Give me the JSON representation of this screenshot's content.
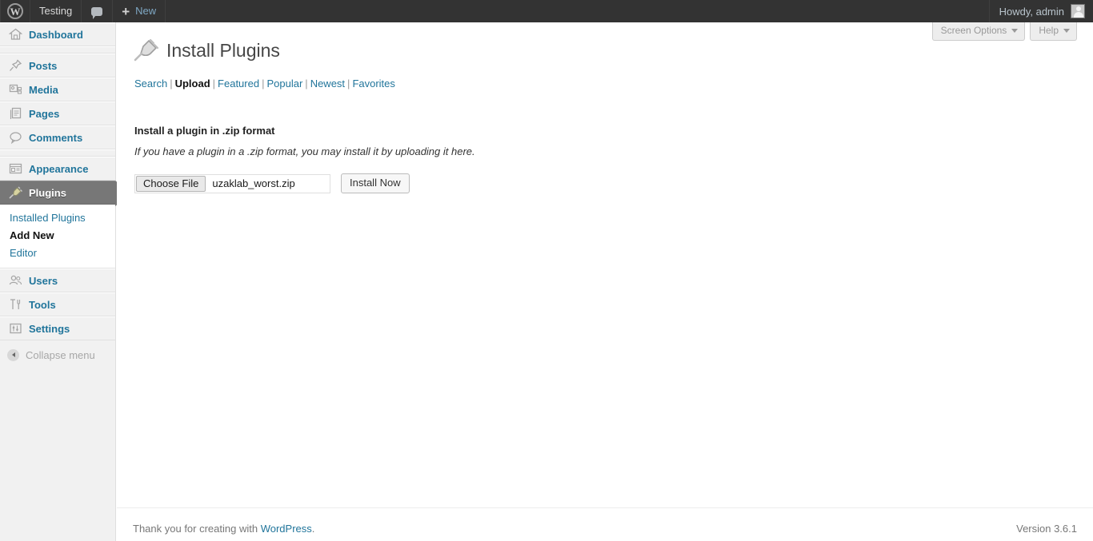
{
  "adminbar": {
    "logo_icon": "wordpress-logo-icon",
    "site_name": "Testing",
    "comments_icon": "comment-bubble-icon",
    "new_plus": "+",
    "new_label": "New",
    "howdy": "Howdy, admin",
    "avatar_icon": "user-avatar-icon"
  },
  "sidebar": {
    "items": [
      {
        "label": "Dashboard",
        "icon": "dashboard-home-icon",
        "current": false
      },
      {
        "label": "Posts",
        "icon": "posts-pin-icon",
        "current": false
      },
      {
        "label": "Media",
        "icon": "media-icon",
        "current": false
      },
      {
        "label": "Pages",
        "icon": "pages-icon",
        "current": false
      },
      {
        "label": "Comments",
        "icon": "comments-icon",
        "current": false
      },
      {
        "label": "Appearance",
        "icon": "appearance-icon",
        "current": false
      },
      {
        "label": "Plugins",
        "icon": "plugins-plug-icon",
        "current": true
      },
      {
        "label": "Users",
        "icon": "users-icon",
        "current": false
      },
      {
        "label": "Tools",
        "icon": "tools-icon",
        "current": false
      },
      {
        "label": "Settings",
        "icon": "settings-icon",
        "current": false
      }
    ],
    "plugins_submenu": [
      {
        "label": "Installed Plugins",
        "current": false
      },
      {
        "label": "Add New",
        "current": true
      },
      {
        "label": "Editor",
        "current": false
      }
    ],
    "collapse": {
      "label": "Collapse menu",
      "icon": "collapse-arrow-icon"
    }
  },
  "screen_meta": {
    "screen_options": "Screen Options",
    "help": "Help"
  },
  "main": {
    "page_icon": "plugin-plug-icon",
    "page_title": "Install Plugins",
    "tabs": [
      {
        "label": "Search",
        "current": false
      },
      {
        "label": "Upload",
        "current": true
      },
      {
        "label": "Featured",
        "current": false
      },
      {
        "label": "Popular",
        "current": false
      },
      {
        "label": "Newest",
        "current": false
      },
      {
        "label": "Favorites",
        "current": false
      }
    ],
    "tab_separator": "|",
    "upload": {
      "heading": "Install a plugin in .zip format",
      "description": "If you have a plugin in a .zip format, you may install it by uploading it here.",
      "choose_file_label": "Choose File",
      "file_name": "uzaklab_worst.zip",
      "submit_label": "Install Now"
    }
  },
  "footer": {
    "thanks_prefix": "Thank you for creating with ",
    "wordpress_link": "WordPress",
    "thanks_suffix": ".",
    "version": "Version 3.6.1"
  },
  "colors": {
    "adminbar_bg": "#333333",
    "sidebar_bg": "#f1f1f1",
    "link_blue": "#21759b",
    "current_menu_bg": "#777777",
    "content_bg": "#ffffff"
  }
}
